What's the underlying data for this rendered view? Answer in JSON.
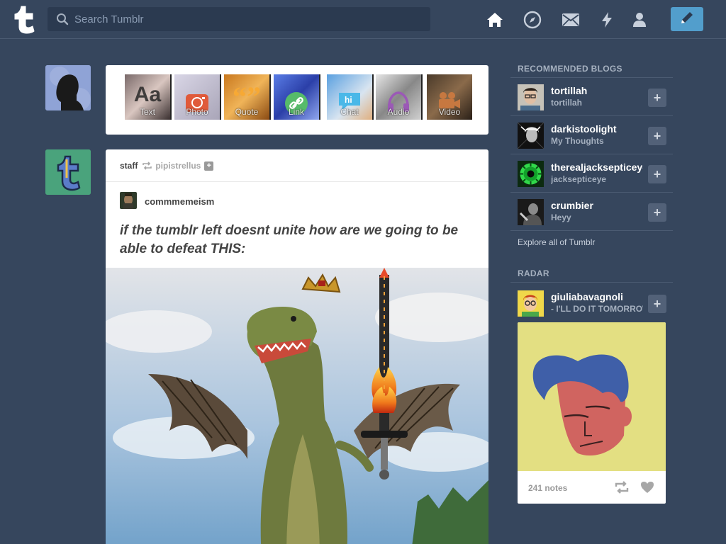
{
  "header": {
    "logo_letter": "t",
    "search_placeholder": "Search Tumblr",
    "nav": [
      "home-icon",
      "explore-icon",
      "messages-icon",
      "activity-icon",
      "account-icon"
    ],
    "compose_icon": "pencil-icon",
    "accent": "#529ecc",
    "background": "#36465d"
  },
  "post_types": [
    {
      "label": "Text",
      "icon": "text-icon",
      "glyph": "Aa"
    },
    {
      "label": "Photo",
      "icon": "camera-icon"
    },
    {
      "label": "Quote",
      "icon": "quote-icon"
    },
    {
      "label": "Link",
      "icon": "link-icon"
    },
    {
      "label": "Chat",
      "icon": "chat-icon"
    },
    {
      "label": "Audio",
      "icon": "headphones-icon"
    },
    {
      "label": "Video",
      "icon": "video-icon"
    }
  ],
  "post": {
    "reblogger": "staff",
    "reblogged_from": "pipistrellus",
    "op_name": "commmemeism",
    "title": "if the tumblr left doesnt unite how are we going to be able to defeat THIS:"
  },
  "sidebar": {
    "recommended_title": "RECOMMENDED BLOGS",
    "blogs": [
      {
        "name": "tortillah",
        "subtitle": "tortillah"
      },
      {
        "name": "darkistoolight",
        "subtitle": "My Thoughts"
      },
      {
        "name": "therealjacksepticeye",
        "subtitle": "jacksepticeye"
      },
      {
        "name": "crumbier",
        "subtitle": "Heyy"
      }
    ],
    "explore": "Explore all of Tumblr",
    "radar_title": "RADAR",
    "radar": {
      "name": "giuliabavagnoli",
      "subtitle": "- I'LL DO IT TOMORROW",
      "notes": "241 notes"
    }
  }
}
